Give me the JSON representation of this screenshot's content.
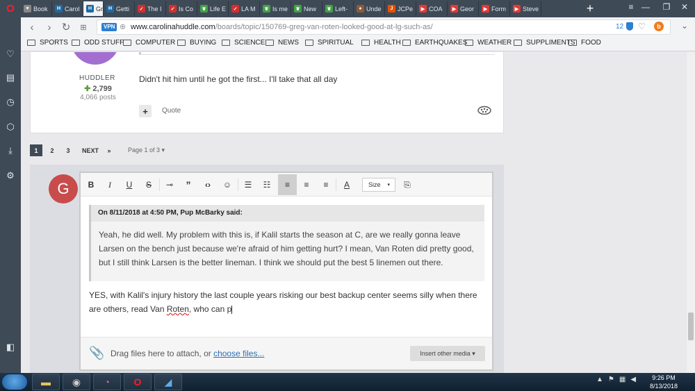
{
  "browser": {
    "tabs": [
      {
        "label": "Book",
        "fav": "#888",
        "glyph": "♥"
      },
      {
        "label": "Carol",
        "fav": "#1d6aa5",
        "glyph": "H"
      },
      {
        "label": "Gre",
        "fav": "#1d6aa5",
        "glyph": "H",
        "active": true
      },
      {
        "label": "Getti",
        "fav": "#1d6aa5",
        "glyph": "H"
      },
      {
        "label": "The I",
        "fav": "#d32f2f",
        "glyph": "✓"
      },
      {
        "label": "Is Co",
        "fav": "#d32f2f",
        "glyph": "✓"
      },
      {
        "label": "Life E",
        "fav": "#43a047",
        "glyph": "❦"
      },
      {
        "label": "LA M",
        "fav": "#d32f2f",
        "glyph": "✓"
      },
      {
        "label": "Is me",
        "fav": "#43a047",
        "glyph": "❦"
      },
      {
        "label": "New",
        "fav": "#43a047",
        "glyph": "❦"
      },
      {
        "label": "Left-",
        "fav": "#43a047",
        "glyph": "❦"
      },
      {
        "label": "Unde",
        "fav": "#8d5a3a",
        "glyph": "●"
      },
      {
        "label": "JCPe",
        "fav": "#e65100",
        "glyph": "J"
      },
      {
        "label": "COA",
        "fav": "#e53935",
        "glyph": "▶"
      },
      {
        "label": "Geor",
        "fav": "#e53935",
        "glyph": "▶"
      },
      {
        "label": "Form",
        "fav": "#e53935",
        "glyph": "▶"
      },
      {
        "label": "Steve",
        "fav": "#e53935",
        "glyph": "▶"
      }
    ],
    "url_domain": "www.carolinahuddle.com",
    "url_path": "/boards/topic/150769-greg-van-roten-looked-good-at-lg-such-as/",
    "vpn_label": "VPN",
    "badge_count": "12",
    "bookmarks": [
      "SPORTS",
      "ODD STUFF",
      "COMPUTER",
      "BUYING",
      "SCIENCE",
      "NEWS",
      "SPIRITUAL",
      "HEALTH",
      "EARTHQUAKES",
      "WEATHER",
      "SUPPLIMENTS",
      "FOOD"
    ]
  },
  "post": {
    "role": "HUDDLER",
    "reputation": "2,799",
    "posts": "4,066 posts",
    "text": "Didn't hit him until he got the first... I'll take that all day",
    "quote_label": "Quote"
  },
  "pagination": {
    "pages": [
      "1",
      "2",
      "3"
    ],
    "next": "NEXT",
    "last": "»",
    "page_of": "Page 1 of 3 ▾"
  },
  "editor": {
    "avatar_letter": "G",
    "size_label": "Size",
    "quote_header": "On 8/11/2018 at 4:50 PM, Pup McBarky said:",
    "quote_body": "Yeah, he did well. My problem with this is, if Kalil starts the season at C, are we really gonna leave Larsen on the bench just because we're afraid of him getting hurt? I mean, Van Roten did pretty good, but I still think Larsen is the better lineman. I think we should put the best 5 linemen out there.",
    "reply_before": "YES, with Kalil's injury history the last couple years risking our best backup center seems silly when there are others, read Van ",
    "reply_misspelled": "Roten",
    "reply_after": ", who can p",
    "attach_text": "Drag files here to attach, or ",
    "attach_link": "choose files...",
    "insert_media": "Insert other media ▾"
  },
  "taskbar": {
    "time": "9:26 PM",
    "date": "8/13/2018"
  }
}
